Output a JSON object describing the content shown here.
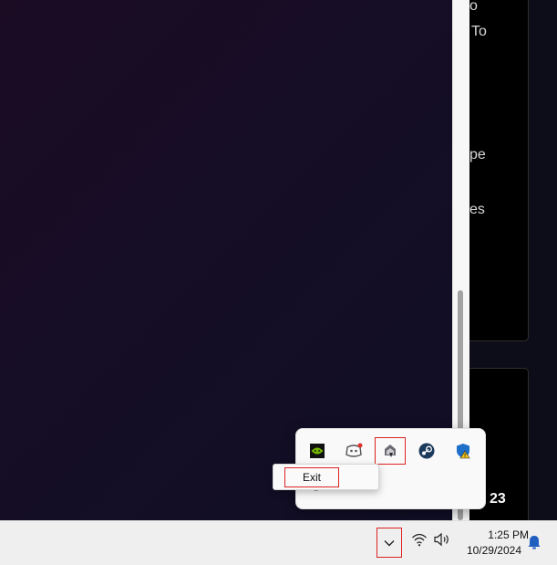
{
  "background_panel": {
    "card_1_fragments": [
      "o",
      "To",
      "pe",
      "es"
    ],
    "card_2_fragment": "23"
  },
  "flyout": {
    "icons": [
      "nvidia-icon",
      "discord-icon",
      "cloud-app-icon",
      "steam-icon",
      "windows-security-icon"
    ],
    "edit_icon": "pencil-icon"
  },
  "context_menu": {
    "items": [
      {
        "label": "Exit"
      }
    ]
  },
  "taskbar": {
    "time": "1:25 PM",
    "date": "10/29/2024",
    "icons": [
      "chevron-up-icon",
      "wifi-icon",
      "speaker-icon",
      "notification-bell-icon"
    ]
  },
  "colors": {
    "highlight_box": "#dd2222",
    "bell": "#1f5fbf"
  }
}
